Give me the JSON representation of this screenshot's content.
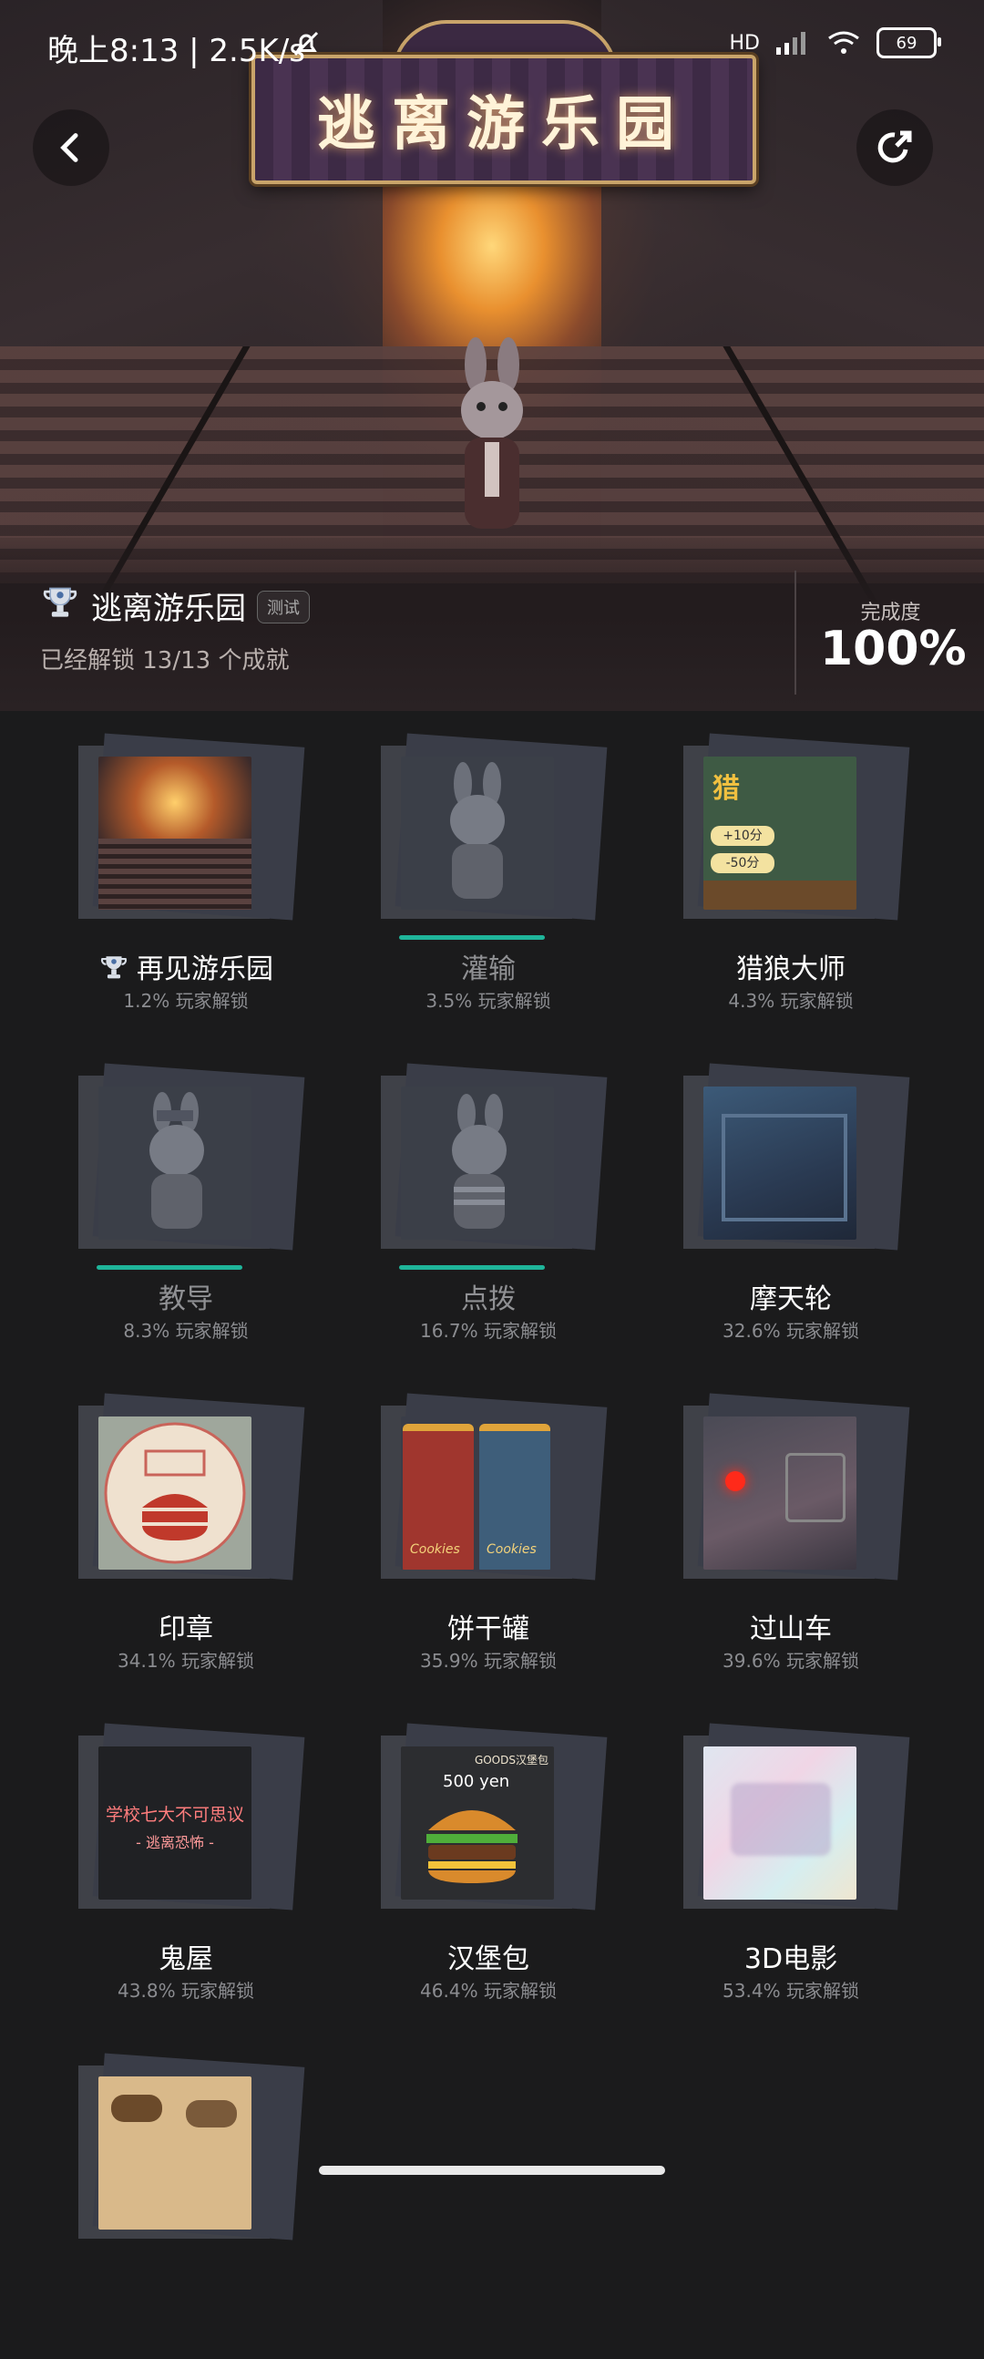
{
  "status_bar": {
    "time": "晚上8:13 | 2.5K/s",
    "network": "HD",
    "battery": "69"
  },
  "hero": {
    "sign_title": "逃离游乐园",
    "icons": {
      "back": "chevron-left-icon",
      "share": "share-icon"
    }
  },
  "info": {
    "game_name": "逃离游乐园",
    "tag": "测试",
    "unlocked_text": "已经解锁 13/13 个成就",
    "completion_label": "完成度",
    "completion_value": "100%"
  },
  "achievements": [
    {
      "name": "再见游乐园",
      "pct": "1.2% 玩家解锁",
      "trophy": true,
      "dim": false,
      "bar": false,
      "theme": "park"
    },
    {
      "name": "灌输",
      "pct": "3.5% 玩家解锁",
      "trophy": false,
      "dim": true,
      "bar": true,
      "theme": "rabbit"
    },
    {
      "name": "猎狼大师",
      "pct": "4.3% 玩家解锁",
      "trophy": false,
      "dim": false,
      "bar": false,
      "theme": "poster"
    },
    {
      "name": "教导",
      "pct": "8.3% 玩家解锁",
      "trophy": false,
      "dim": true,
      "bar": true,
      "theme": "rabbit2"
    },
    {
      "name": "点拨",
      "pct": "16.7% 玩家解锁",
      "trophy": false,
      "dim": true,
      "bar": true,
      "theme": "rabbit3"
    },
    {
      "name": "摩天轮",
      "pct": "32.6% 玩家解锁",
      "trophy": false,
      "dim": false,
      "bar": false,
      "theme": "cabin"
    },
    {
      "name": "印章",
      "pct": "34.1% 玩家解锁",
      "trophy": false,
      "dim": false,
      "bar": false,
      "theme": "stamp"
    },
    {
      "name": "饼干罐",
      "pct": "35.9% 玩家解锁",
      "trophy": false,
      "dim": false,
      "bar": false,
      "theme": "cookies"
    },
    {
      "name": "过山车",
      "pct": "39.6% 玩家解锁",
      "trophy": false,
      "dim": false,
      "bar": false,
      "theme": "panel"
    },
    {
      "name": "鬼屋",
      "pct": "43.8% 玩家解锁",
      "trophy": false,
      "dim": false,
      "bar": false,
      "theme": "board"
    },
    {
      "name": "汉堡包",
      "pct": "46.4% 玩家解锁",
      "trophy": false,
      "dim": false,
      "bar": false,
      "theme": "burger"
    },
    {
      "name": "3D电影",
      "pct": "53.4% 玩家解锁",
      "trophy": false,
      "dim": false,
      "bar": false,
      "theme": "glitch"
    },
    {
      "name": "",
      "pct": "",
      "trophy": false,
      "dim": false,
      "bar": false,
      "theme": "horses"
    }
  ],
  "colors": {
    "background": "#1b1b1c",
    "progress": "#1fb59a",
    "card_back": "#3f4148"
  },
  "thumbs": {
    "poster_line1": "猎",
    "poster_line2": "+10分",
    "poster_line3": "-50分",
    "cookie_label": "Cookies",
    "burger_header": "GOODS汉堡包",
    "burger_price": "500 yen",
    "board_title": "学校七大不可思议",
    "board_sub": "- 逃离恐怖 -"
  }
}
